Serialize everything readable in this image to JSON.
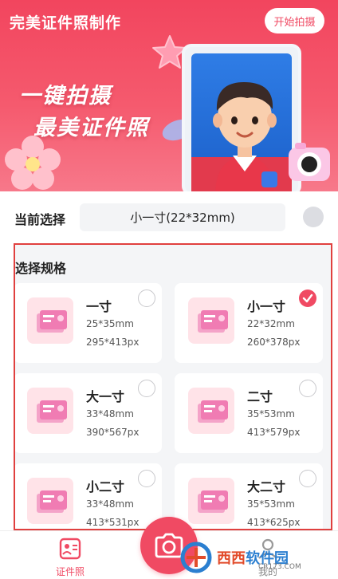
{
  "header": {
    "app_title": "完美证件照制作",
    "start_button": "开始拍摄"
  },
  "banner": {
    "slogan_line1": "一键拍摄",
    "slogan_line2": "最美证件照"
  },
  "current": {
    "label": "当前选择",
    "value": "小一寸(22*32mm)"
  },
  "spec": {
    "title": "选择规格",
    "items": [
      {
        "name": "一寸",
        "size": "25*35mm",
        "px": "295*413px",
        "checked": false
      },
      {
        "name": "小一寸",
        "size": "22*32mm",
        "px": "260*378px",
        "checked": true
      },
      {
        "name": "大一寸",
        "size": "33*48mm",
        "px": "390*567px",
        "checked": false
      },
      {
        "name": "二寸",
        "size": "35*53mm",
        "px": "413*579px",
        "checked": false
      },
      {
        "name": "小二寸",
        "size": "33*48mm",
        "px": "413*531px",
        "checked": false
      },
      {
        "name": "大二寸",
        "size": "35*53mm",
        "px": "413*625px",
        "checked": false
      }
    ]
  },
  "nav": {
    "left_label": "证件照",
    "right_label": "我的"
  },
  "watermark": {
    "main": "西西",
    "sub": "软件园",
    "site": "CR173.COM"
  },
  "colors": {
    "accent": "#f04a63",
    "banner": "#f2455e",
    "highlight_border": "#e0403f"
  }
}
